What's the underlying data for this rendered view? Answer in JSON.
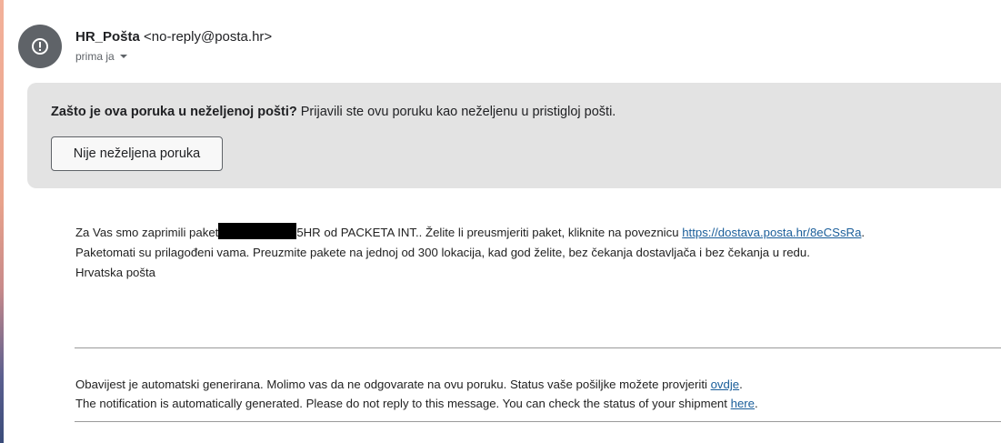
{
  "sender": {
    "name": "HR_Pošta",
    "email": "<no-reply@posta.hr>",
    "recipient": "prima ja"
  },
  "spam_banner": {
    "question": "Zašto je ova poruka u neželjenoj pošti?",
    "explanation": " Prijavili ste ovu poruku kao neželjenu u pristigloj pošti.",
    "button_label": "Nije neželjena poruka"
  },
  "message": {
    "line1_before": "Za Vas smo zaprimili paket",
    "line1_after": "5HR od PACKETA INT.. Želite li preusmjeriti paket, kliknite na poveznicu ",
    "link_text": "https://dostava.posta.hr/8eCSsRa",
    "line1_end": ".",
    "line2": "Paketomati su prilagođeni vama. Preuzmite pakete na jednoj od 300 lokacija, kad god želite, bez čekanja dostavljača i bez čekanja u redu.",
    "signature": "Hrvatska pošta"
  },
  "footer": {
    "hr_text": "Obavijest je automatski generirana. Molimo vas da ne odgovarate na ovu poruku. Status vaše pošiljke možete provjeriti ",
    "hr_link": "ovdje",
    "hr_end": ".",
    "en_text": "The notification is automatically generated. Please do not reply to this message. You can check the status of your shipment ",
    "en_link": "here",
    "en_end": "."
  }
}
